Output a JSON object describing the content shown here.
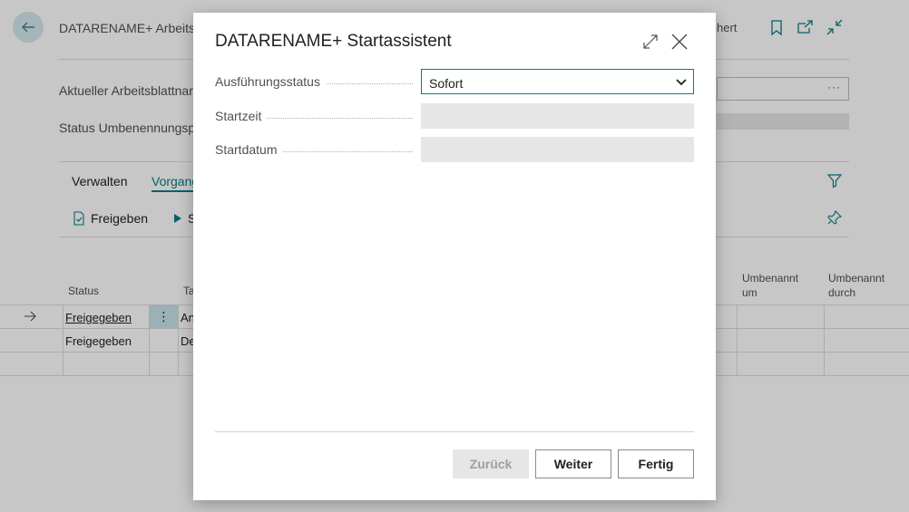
{
  "background": {
    "title": "DATARENAME+ Arbeitsb",
    "saved_text": "hert",
    "fields": [
      {
        "label": "Aktueller Arbeitsblattnar"
      },
      {
        "label": "Status Umbenennungsp"
      }
    ],
    "input_more": "···",
    "action_tabs": [
      "Verwalten",
      "Vorgang"
    ],
    "actions": [
      {
        "label": "Freigeben"
      },
      {
        "label": "S"
      }
    ],
    "columns": {
      "status": "Status",
      "ta": "Ta",
      "renamed_at_1": "Umbenannt",
      "renamed_at_2": "um",
      "renamed_by_1": "Umbenannt",
      "renamed_by_2": "durch"
    },
    "rows": [
      {
        "status": "Freigegeben",
        "ta": "An"
      },
      {
        "status": "Freigegeben",
        "ta": "De"
      }
    ],
    "row_menu_glyph": "⋮"
  },
  "dialog": {
    "title": "DATARENAME+ Startassistent",
    "fields": {
      "execution_status": {
        "label": "Ausführungsstatus",
        "value": "Sofort"
      },
      "start_time": {
        "label": "Startzeit",
        "value": ""
      },
      "start_date": {
        "label": "Startdatum",
        "value": ""
      }
    },
    "buttons": {
      "back": "Zurück",
      "next": "Weiter",
      "finish": "Fertig"
    }
  },
  "colors": {
    "accent": "#0a7a87",
    "overlay": "#000000"
  }
}
